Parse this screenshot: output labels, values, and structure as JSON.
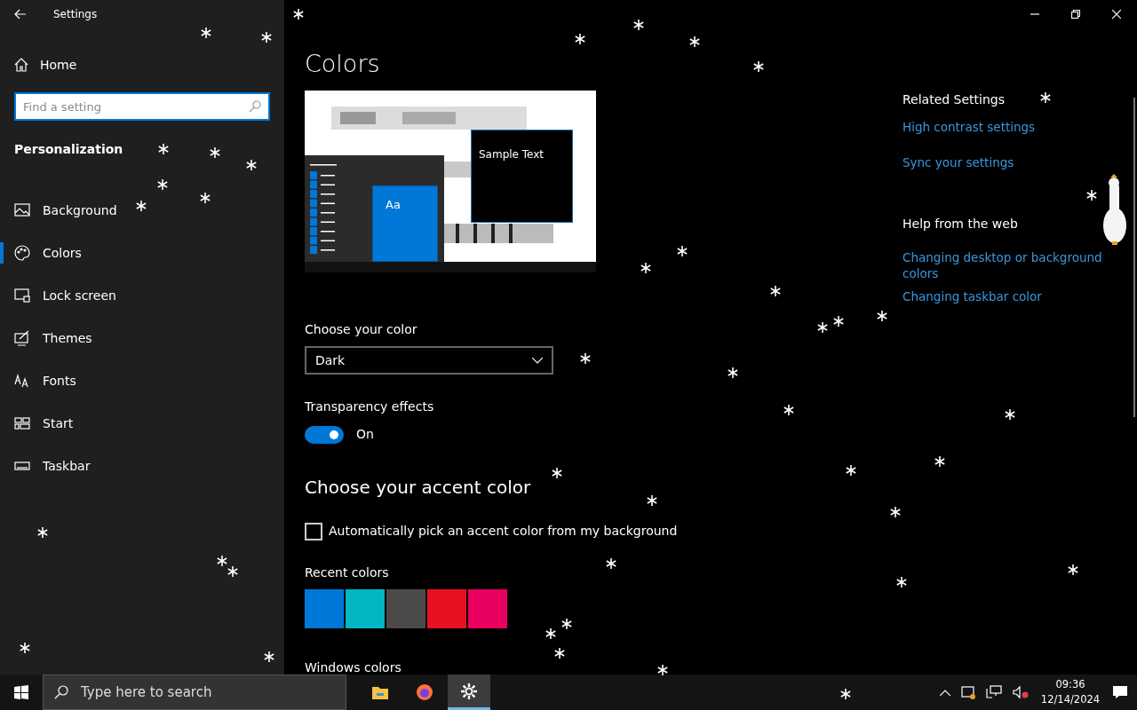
{
  "window": {
    "title": "Settings"
  },
  "sidebar": {
    "home": "Home",
    "search": {
      "placeholder": "Find a setting"
    },
    "section": "Personalization",
    "items": [
      {
        "label": "Background",
        "selected": false
      },
      {
        "label": "Colors",
        "selected": true
      },
      {
        "label": "Lock screen",
        "selected": false
      },
      {
        "label": "Themes",
        "selected": false
      },
      {
        "label": "Fonts",
        "selected": false
      },
      {
        "label": "Start",
        "selected": false
      },
      {
        "label": "Taskbar",
        "selected": false
      }
    ]
  },
  "main": {
    "title": "Colors",
    "preview": {
      "tile_label": "Aa",
      "sample_text": "Sample Text"
    },
    "choose_color": {
      "label": "Choose your color",
      "value": "Dark"
    },
    "transparency": {
      "label": "Transparency effects",
      "on": true,
      "state_text": "On"
    },
    "accent_heading": "Choose your accent color",
    "auto_pick": {
      "label": "Automatically pick an accent color from my background",
      "checked": false
    },
    "recent_colors": {
      "label": "Recent colors",
      "swatches": [
        {
          "color": "#0078d7"
        },
        {
          "color": "#00b7c3"
        },
        {
          "color": "#4c4a48"
        },
        {
          "color": "#e81123"
        },
        {
          "color": "#ea005e"
        }
      ]
    },
    "windows_colors_label": "Windows colors"
  },
  "related": {
    "heading": "Related Settings",
    "links": [
      "High contrast settings",
      "Sync your settings"
    ]
  },
  "help": {
    "heading": "Help from the web",
    "links": [
      "Changing desktop or background colors",
      "Changing taskbar color"
    ]
  },
  "taskbar": {
    "search_placeholder": "Type here to search",
    "apps": [
      {
        "selected": false
      },
      {
        "selected": false
      },
      {
        "selected": true
      }
    ],
    "time": "09:36",
    "date": "12/14/2024"
  }
}
